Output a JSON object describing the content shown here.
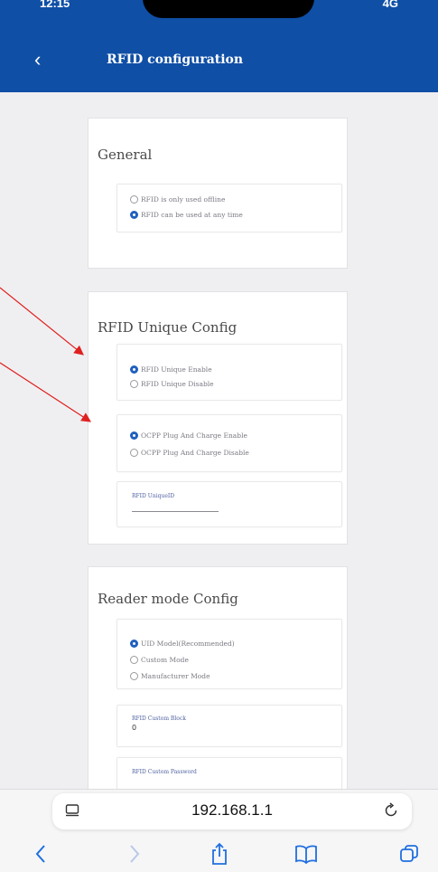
{
  "status": {
    "time": "12:15",
    "signal": "4G"
  },
  "header": {
    "back_symbol": "‹",
    "title": "RFID configuration"
  },
  "general": {
    "title": "General",
    "options": [
      {
        "label": "RFID is only used offline",
        "checked": false
      },
      {
        "label": "RFID can be used at any time",
        "checked": true
      }
    ]
  },
  "unique": {
    "title": "RFID Unique Config",
    "unique_options": [
      {
        "label": "RFID Unique Enable",
        "checked": true
      },
      {
        "label": "RFID Unique Disable",
        "checked": false
      }
    ],
    "plug_options": [
      {
        "label": "OCPP Plug And Charge Enable",
        "checked": true
      },
      {
        "label": "OCPP Plug And Charge Disable",
        "checked": false
      }
    ],
    "uniqueid_label": "RFID UniqueID",
    "uniqueid_value": ""
  },
  "reader": {
    "title": "Reader mode Config",
    "mode_options": [
      {
        "label": "UID Model(Recommended)",
        "checked": true
      },
      {
        "label": "Custom Mode",
        "checked": false
      },
      {
        "label": "Manufacturer Mode",
        "checked": false
      }
    ],
    "block_label": "RFID Custom Block",
    "block_value": "0",
    "password_label": "RFID Custom Password"
  },
  "browser": {
    "url": "192.168.1.1"
  },
  "colors": {
    "header_bg": "#0f4fa6",
    "accent": "#1f5fbf",
    "annotation_arrow": "#e0201f"
  }
}
